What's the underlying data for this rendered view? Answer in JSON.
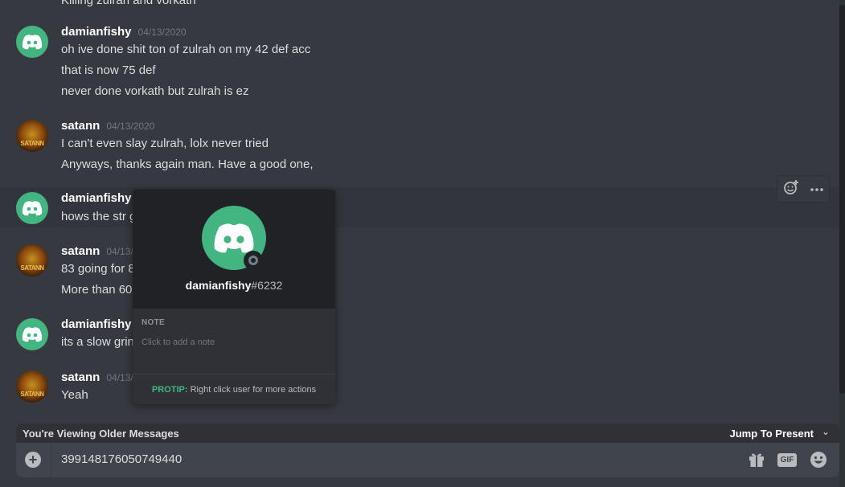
{
  "top_partial_text": "Killing zulrah and vorkath",
  "messages": [
    {
      "author": "damianfishy",
      "timestamp": "04/13/2020",
      "avatar": "discord-logo",
      "lines": [
        "oh ive done shit ton of zulrah on my 42 def acc",
        "that is now 75 def",
        "never done vorkath but zulrah is ez"
      ]
    },
    {
      "author": "satann",
      "timestamp": "04/13/2020",
      "avatar": "satann-avatar",
      "avatar_text": "SATANN",
      "lines": [
        "I can't even slay zulrah, lolx never tried",
        "Anyways, thanks again man. Have a good one,"
      ]
    },
    {
      "author": "damianfishy",
      "timestamp": "",
      "avatar": "discord-logo",
      "lines": [
        "hows the str g"
      ]
    },
    {
      "author": "satann",
      "timestamp": "04/13/",
      "avatar": "satann-avatar",
      "avatar_text": "SATANN",
      "lines": [
        "83 going for 8",
        "More than 60"
      ]
    },
    {
      "author": "damianfishy",
      "timestamp": "",
      "avatar": "discord-logo",
      "lines": [
        "its a slow grin"
      ]
    },
    {
      "author": "satann",
      "timestamp": "04/13/",
      "avatar": "satann-avatar",
      "avatar_text": "SATANN",
      "lines": [
        "Yeah"
      ]
    }
  ],
  "popout": {
    "username": "damianfishy",
    "discriminator": "#6232",
    "note_label": "NOTE",
    "note_placeholder": "Click to add a note",
    "protip_tag": "PROTIP:",
    "protip_text": "Right click user for more actions"
  },
  "older_bar": {
    "left_text": "You're Viewing Older Messages",
    "right_text": "Jump To Present"
  },
  "composer": {
    "value": "399148176050749440",
    "gif_label": "GIF"
  },
  "colors": {
    "background": "#36393f",
    "brand_green": "#43b581",
    "popout_header": "#202225"
  }
}
